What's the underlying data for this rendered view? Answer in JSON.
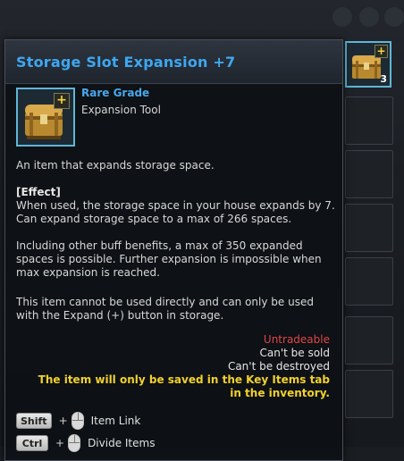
{
  "item": {
    "title": "Storage Slot Expansion +7",
    "grade": "Rare Grade",
    "type": "Expansion Tool",
    "plus_badge": "+",
    "description": "An item that expands storage space.",
    "effect_header": "[Effect]",
    "effect_text": "When used, the storage space in your house expands by 7.\nCan expand storage space to a max of 266 spaces.",
    "buff_text": "Including other buff benefits, a max of 350 expanded\nspaces is possible. Further expansion is impossible when\nmax expansion is reached.",
    "usage_text": "This item cannot be used directly and can only be used\nwith the Expand (+) button in storage."
  },
  "status": {
    "untradeable": "Untradeable",
    "cant_sold": "Can't be sold",
    "cant_destroyed": "Can't be destroyed",
    "key_items_note": "The item will only be saved in the Key Items tab in the inventory."
  },
  "hints": [
    {
      "key": "Shift",
      "plus": "+",
      "label": "Item Link"
    },
    {
      "key": "Ctrl",
      "plus": "+",
      "label": "Divide Items"
    }
  ],
  "side_slot": {
    "count": "3",
    "plus_badge": "+"
  },
  "colors": {
    "title": "#3ea7f0",
    "grade": "#4aa8ec",
    "untradeable": "#e04646",
    "key_note": "#f2d12e",
    "icon_border": "#5fb6d6"
  },
  "icons": {
    "item": "treasure-chest-icon",
    "mouse": "mouse-icon"
  }
}
